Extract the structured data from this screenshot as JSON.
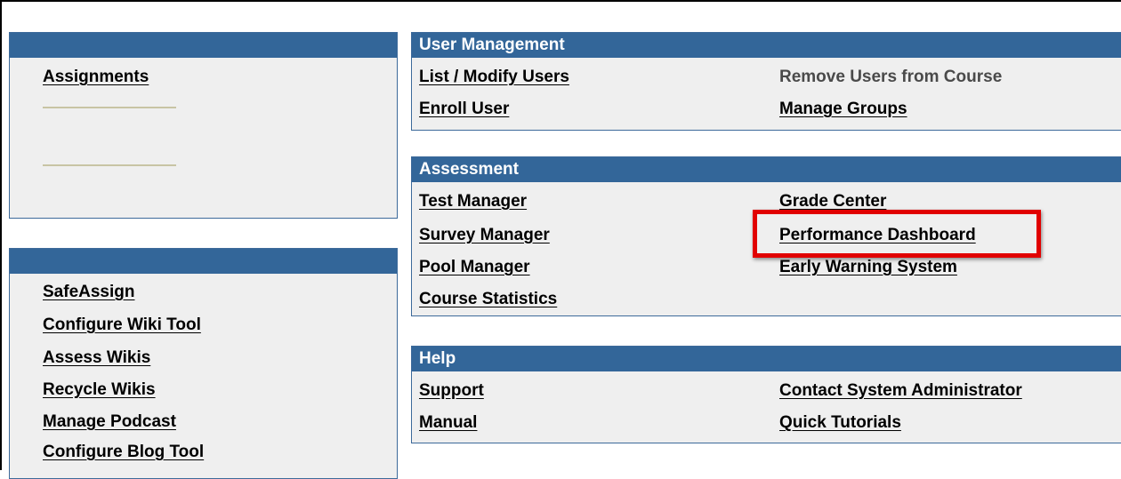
{
  "left_top_panel": {
    "title": "",
    "links": [
      "Assignments"
    ]
  },
  "left_bottom_panel": {
    "title": "",
    "links": [
      "SafeAssign",
      "Configure Wiki Tool",
      "Assess Wikis",
      "Recycle Wikis",
      "Manage Podcast",
      "Configure Blog Tool"
    ]
  },
  "user_management": {
    "title": "User Management",
    "list_modify_users": "List / Modify Users",
    "enroll_user": "Enroll User",
    "remove_users": "Remove Users from Course",
    "manage_groups": "Manage Groups"
  },
  "assessment": {
    "title": "Assessment",
    "test_manager": "Test Manager",
    "survey_manager": "Survey Manager",
    "pool_manager": "Pool Manager",
    "course_statistics": "Course Statistics",
    "grade_center": "Grade Center",
    "performance_dashboard": "Performance Dashboard",
    "early_warning_system": "Early Warning System"
  },
  "help": {
    "title": "Help",
    "support": "Support",
    "manual": "Manual",
    "contact_admin": "Contact System Administrator",
    "quick_tutorials": "Quick Tutorials"
  },
  "colors": {
    "header_bg": "#336699",
    "panel_bg": "#efefef",
    "highlight": "#e10000"
  }
}
